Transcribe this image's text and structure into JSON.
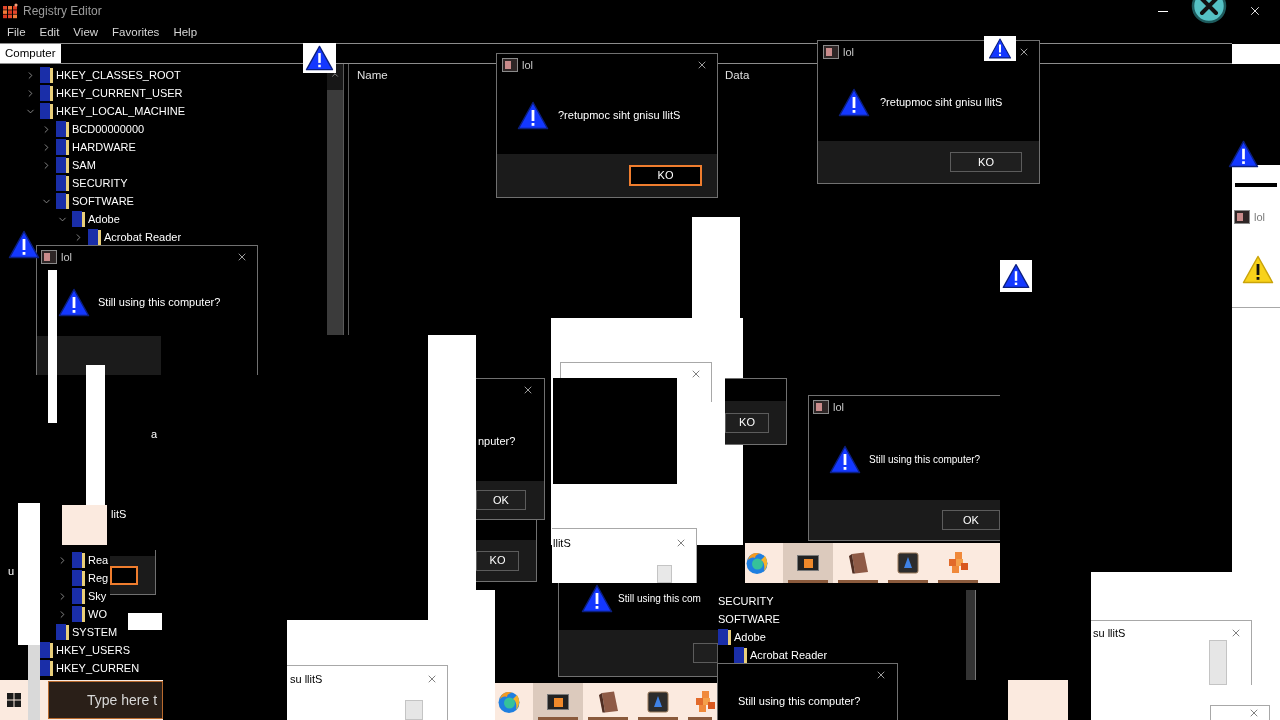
{
  "registry_editor": {
    "title": "Registry Editor",
    "menu": [
      "File",
      "Edit",
      "View",
      "Favorites",
      "Help"
    ],
    "address": "Computer",
    "tree": [
      {
        "label": "HKEY_CLASSES_ROOT",
        "expanded": false
      },
      {
        "label": "HKEY_CURRENT_USER",
        "expanded": false
      },
      {
        "label": "HKEY_LOCAL_MACHINE",
        "expanded": true,
        "children": [
          {
            "label": "BCD00000000",
            "expanded": false
          },
          {
            "label": "HARDWARE",
            "expanded": false
          },
          {
            "label": "SAM",
            "expanded": false
          },
          {
            "label": "SECURITY"
          },
          {
            "label": "SOFTWARE",
            "expanded": true,
            "children": [
              {
                "label": "Adobe",
                "expanded": true,
                "children": [
                  {
                    "label": "Acrobat Reader",
                    "expanded": false
                  }
                ]
              },
              {
                "label": "Rea",
                "expanded": false
              },
              {
                "label": "Reg"
              },
              {
                "label": "Sky",
                "expanded": false
              },
              {
                "label": "WO",
                "expanded": false
              }
            ]
          },
          {
            "label": "SYSTEM"
          }
        ]
      },
      {
        "label": "HKEY_USERS"
      },
      {
        "label": "HKEY_CURREN"
      }
    ],
    "columns": [
      "Name",
      "Data"
    ]
  },
  "dialogs": [
    {
      "kind": "dark",
      "title": "lol",
      "message": "?retupmoc siht gnisu llitS",
      "button": "KO",
      "focused": true
    },
    {
      "kind": "dark",
      "title": "lol",
      "message": "?retupmoc siht gnisu llitS",
      "button": "KO",
      "focused": false
    },
    {
      "kind": "dark",
      "title": "lol",
      "message": "Still using this computer?"
    },
    {
      "kind": "light",
      "title": "lol"
    },
    {
      "kind": "light"
    },
    {
      "kind": "dark",
      "message": "nputer?",
      "button": "OK",
      "focused": false
    },
    {
      "kind": "dark",
      "button": "KO",
      "focused": false
    },
    {
      "kind": "dark",
      "title": "lol",
      "message": "Still using this computer?",
      "button": "OK",
      "focused": false
    },
    {
      "kind": "dark",
      "button": "KO",
      "focused": false
    },
    {
      "kind": "light",
      "message": "llitS"
    },
    {
      "kind": "dark",
      "focused": true
    },
    {
      "kind": "dark",
      "message": "Still using this com",
      "focused": false
    },
    {
      "kind": "light",
      "message": "su llitS"
    },
    {
      "kind": "dark",
      "message": "Still using this computer?"
    },
    {
      "kind": "light",
      "message": "su llitS"
    },
    {
      "kind": "light"
    }
  ],
  "tree_fragment": [
    {
      "label": "SECURITY"
    },
    {
      "label": "SOFTWARE",
      "children": [
        {
          "label": "Adobe",
          "children": [
            {
              "label": "Acrobat Reader"
            }
          ]
        }
      ]
    }
  ],
  "taskbar": {
    "search": {
      "placeholder": "Type here t"
    }
  },
  "taskbar_fragments": [
    {
      "apps": [
        {
          "kind": "browser",
          "selected": false,
          "running": false
        },
        {
          "kind": "registry",
          "selected": true,
          "running": true
        },
        {
          "kind": "notebook",
          "selected": false,
          "running": true
        },
        {
          "kind": "tile",
          "selected": false,
          "running": true
        },
        {
          "kind": "cubes",
          "selected": false,
          "running": true
        }
      ]
    },
    {
      "apps": [
        {
          "kind": "browser",
          "selected": false,
          "running": false
        },
        {
          "kind": "registry",
          "selected": true,
          "running": true
        },
        {
          "kind": "notebook",
          "selected": false,
          "running": true
        },
        {
          "kind": "tile",
          "selected": false,
          "running": true
        },
        {
          "kind": "cubes",
          "selected": false,
          "running": true
        }
      ]
    }
  ],
  "text_fragments": [
    "litS",
    "a",
    "u"
  ]
}
